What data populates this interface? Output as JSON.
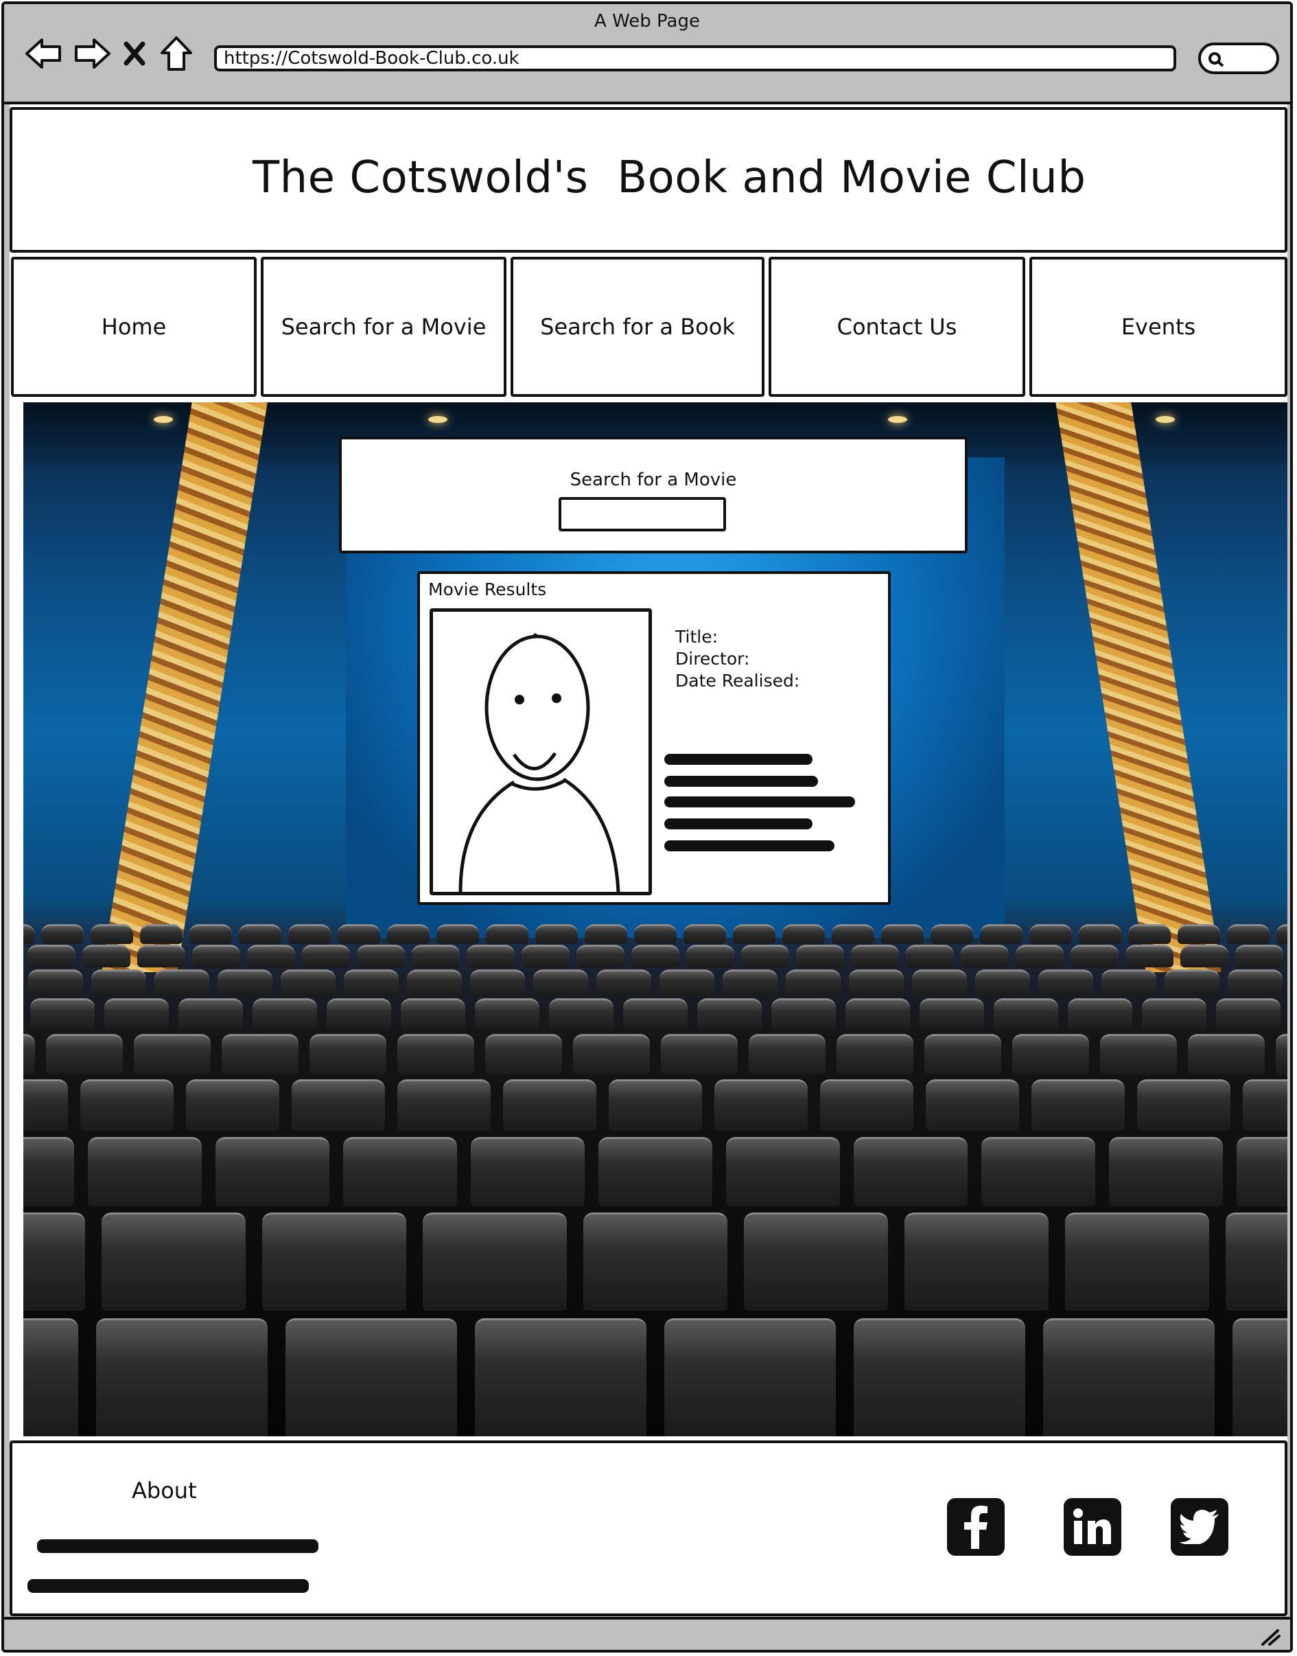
{
  "window": {
    "title": "A Web Page"
  },
  "browser": {
    "url": "https://Cotswold-Book-Club.co.uk",
    "buttons": [
      "back-icon",
      "forward-icon",
      "close-icon",
      "home-icon"
    ]
  },
  "site": {
    "title": "The Cotswold's  Book and Movie Club"
  },
  "nav": {
    "items": [
      {
        "label": "Home"
      },
      {
        "label": "Search for a Movie"
      },
      {
        "label": "Search for a Book"
      },
      {
        "label": "Contact Us"
      },
      {
        "label": "Events"
      }
    ]
  },
  "search": {
    "label": "Search for a Movie",
    "value": ""
  },
  "results": {
    "title": "Movie Results",
    "fields": [
      "Title:",
      "Director:",
      "Date Realised:"
    ]
  },
  "footer": {
    "about_label": "About",
    "social": [
      "facebook-icon",
      "linkedin-icon",
      "twitter-icon"
    ]
  }
}
